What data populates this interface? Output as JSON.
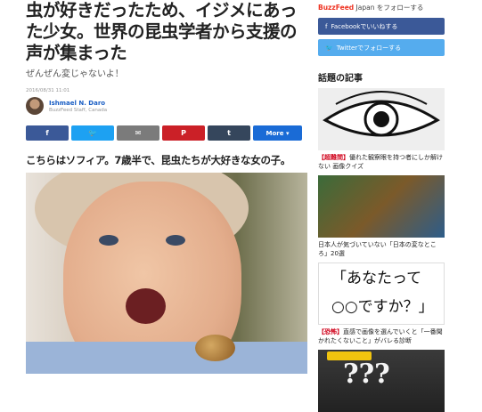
{
  "article": {
    "title": "虫が好きだったため、イジメにあった少女。世界の昆虫学者から支援の声が集まった",
    "subtitle": "ぜんぜん変じゃないよ！",
    "date": "2016/08/31 11:01",
    "author_name": "Ishmael N. Daro",
    "author_meta": "BuzzFeed Staff, Canada",
    "caption": "こちらはソフィア。7歳半で、昆虫たちが大好きな女の子。"
  },
  "share": {
    "facebook_icon": "facebook-icon",
    "twitter_icon": "twitter-icon",
    "mail_icon": "mail-icon",
    "pinterest_icon": "pinterest-icon",
    "tumblr_icon": "tumblr-icon",
    "more_label": "More ▾"
  },
  "sidebar": {
    "follow_brand": "BuzzFeed",
    "follow_text": " Japan をフォローする",
    "facebook_label": "Facebookでいいねする",
    "twitter_label": "Twitterでフォローする",
    "hot_title": "話題の記事",
    "articles": [
      {
        "tag": "【超難問】",
        "text": "優れた観察眼を持つ者にしか解けない 画像クイズ"
      },
      {
        "tag": "",
        "text": "日本人が気づいていない「日本の変なところ」20選"
      },
      {
        "tag": "【恐怖】",
        "text": "直感で画像を選んでいくと「一番聞かれたくないこと」がバレる診断"
      }
    ],
    "thumb3_line1": "「あなたって",
    "thumb3_line2": "○○ですか？」",
    "thumb4_text": "???"
  },
  "colors": {
    "facebook": "#3b5998",
    "twitter": "#1da1f2",
    "pinterest": "#cb2027",
    "tumblr": "#35465c",
    "more": "#1a6bd6",
    "buzzfeed_red": "#ee3322"
  }
}
